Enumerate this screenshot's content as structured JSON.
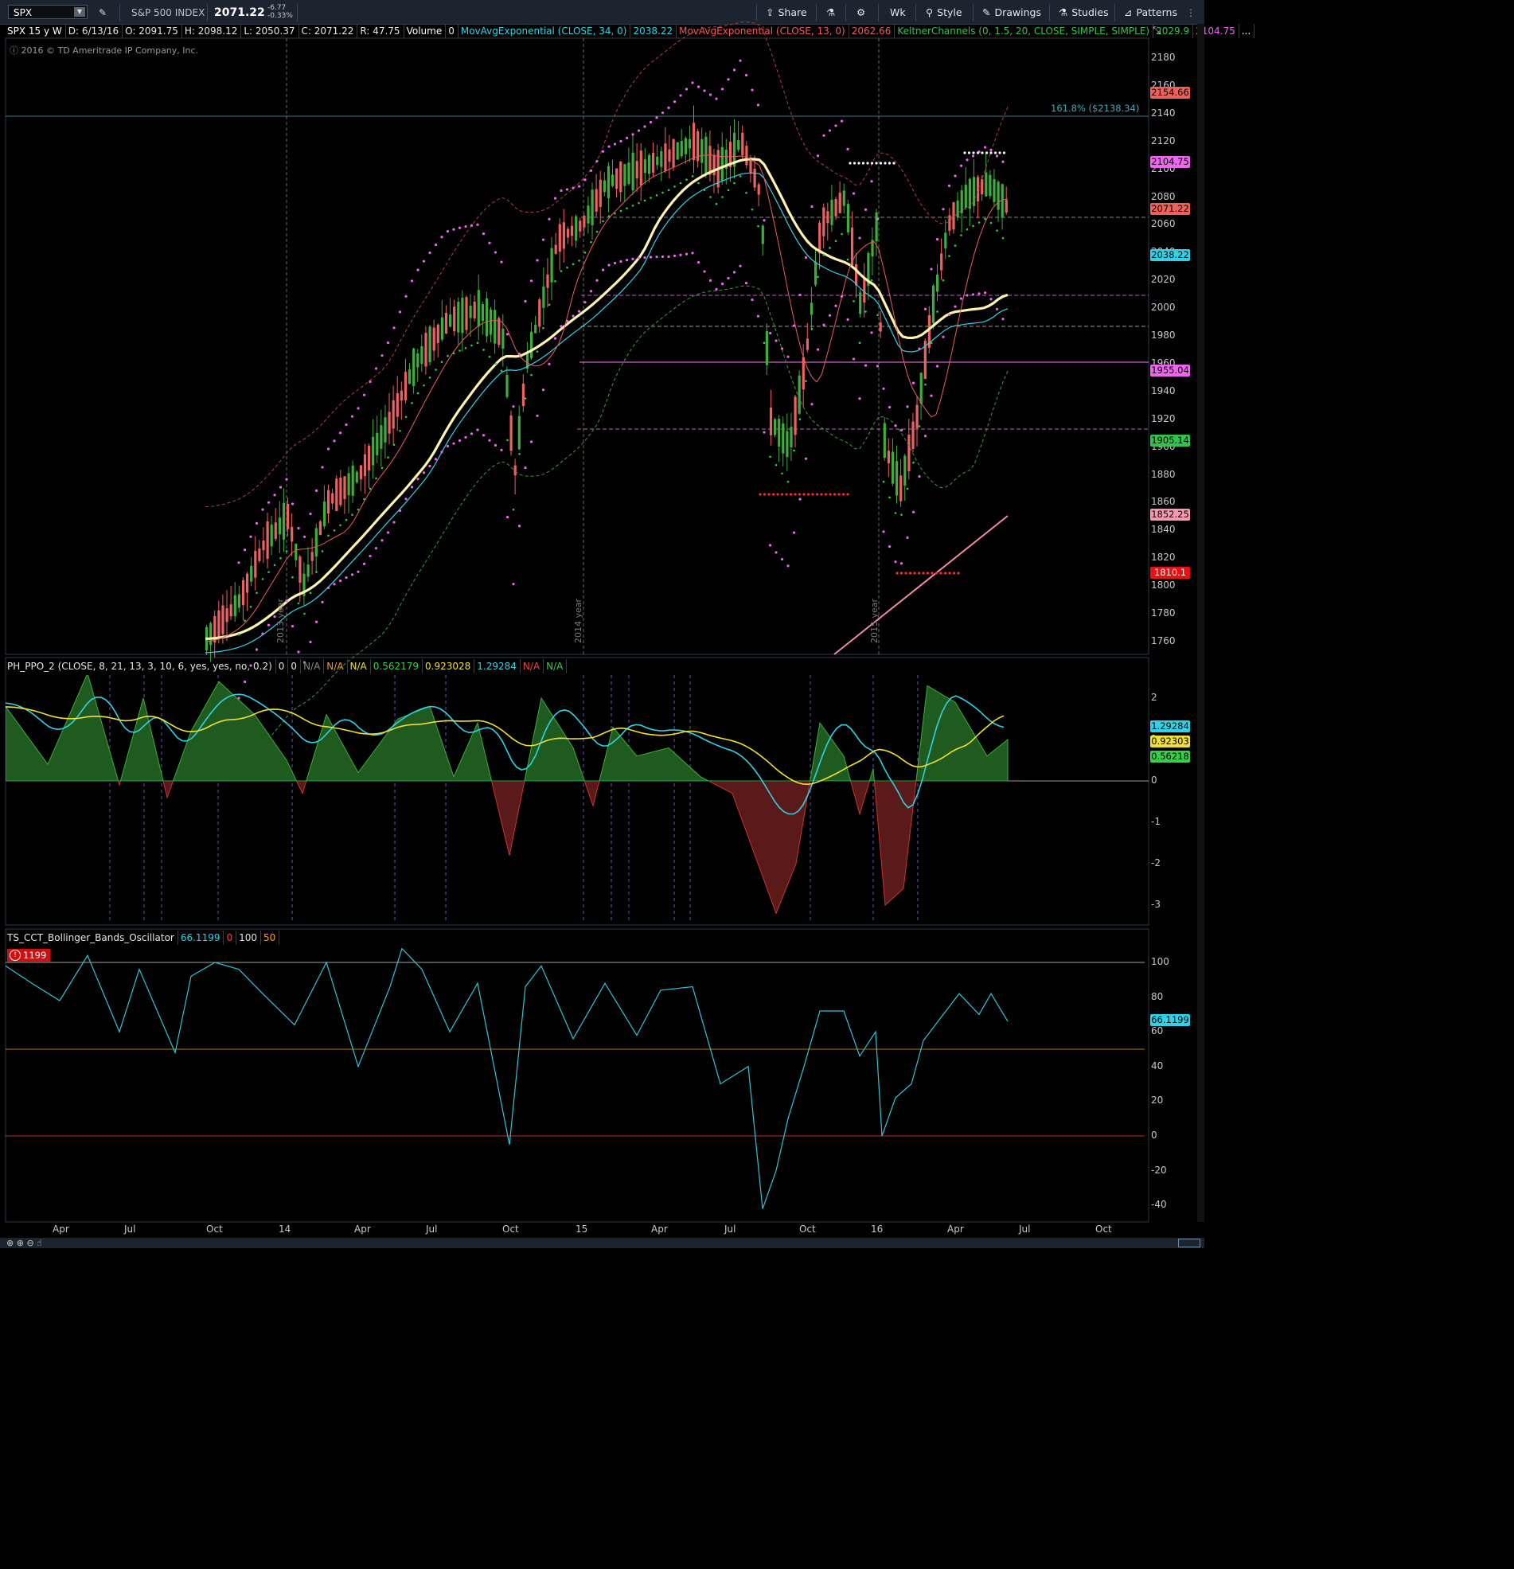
{
  "toolbar": {
    "symbol": "SPX",
    "description": "S&P 500 INDEX",
    "last": "2071.22",
    "change": "-6.77",
    "change_pct": "-0.33%",
    "buttons": {
      "share": "Share",
      "aggregation": "Wk",
      "style": "Style",
      "drawings": "Drawings",
      "studies": "Studies",
      "patterns": "Patterns"
    }
  },
  "infobar": {
    "items": [
      {
        "text": "SPX 15 y W",
        "color": "#ffffff"
      },
      {
        "text": "D: 6/13/16",
        "color": "#e6e6e6"
      },
      {
        "text": "O: 2091.75",
        "color": "#e6e6e6"
      },
      {
        "text": "H: 2098.12",
        "color": "#e6e6e6"
      },
      {
        "text": "L: 2050.37",
        "color": "#e6e6e6"
      },
      {
        "text": "C: 2071.22",
        "color": "#e6e6e6"
      },
      {
        "text": "R: 47.75",
        "color": "#e6e6e6"
      },
      {
        "text": "Volume",
        "color": "#ffffff"
      },
      {
        "text": "0",
        "color": "#e6e6e6"
      },
      {
        "text": "MovAvgExponential (CLOSE, 34, 0)",
        "color": "#2fd2e6"
      },
      {
        "text": "2038.22",
        "color": "#2fd2e6"
      },
      {
        "text": "MovAvgExponential (CLOSE, 13, 0)",
        "color": "#f05a5a"
      },
      {
        "text": "2062.66",
        "color": "#f05a5a"
      },
      {
        "text": "KeltnerChannels (0, 1.5, 20, CLOSE, SIMPLE, SIMPLE)",
        "color": "#34c34a"
      },
      {
        "text": "2029.9",
        "color": "#34c34a"
      },
      {
        "text": "2104.75",
        "color": "#ee66ee"
      },
      {
        "text": "...",
        "color": "#ffffff"
      }
    ],
    "copyright": "2016 © TD Ameritrade IP Company, Inc."
  },
  "ppo_bar": {
    "items": [
      {
        "text": "PH_PPO_2 (CLOSE, 8, 21, 13, 3, 10, 6, yes, yes, no, 0.2)",
        "color": "#e6e6e6"
      },
      {
        "text": "0",
        "color": "#e6e6e6"
      },
      {
        "text": "0",
        "color": "#e6e6e6"
      },
      {
        "text": "N/A",
        "color": "#8a8a8a"
      },
      {
        "text": "N/A",
        "color": "#f0a020"
      },
      {
        "text": "N/A",
        "color": "#f0e030"
      },
      {
        "text": "0.562179",
        "color": "#34d04a"
      },
      {
        "text": "0.923028",
        "color": "#f0e030"
      },
      {
        "text": "1.29284",
        "color": "#2fd2e6"
      },
      {
        "text": "N/A",
        "color": "#f04040"
      },
      {
        "text": "N/A",
        "color": "#34d04a"
      }
    ]
  },
  "bb_bar": {
    "items": [
      {
        "text": "TS_CCT_Bollinger_Bands_Oscillator",
        "color": "#e6e6e6"
      },
      {
        "text": "66.1199",
        "color": "#2fd2e6"
      },
      {
        "text": "0",
        "color": "#f04040"
      },
      {
        "text": "100",
        "color": "#e6e6e6"
      },
      {
        "text": "50",
        "color": "#f0a020"
      }
    ],
    "alert_value": "1199"
  },
  "price_panel": {
    "fib_label": "161.8%  ($2138.34)",
    "year_labels": [
      "2013 year",
      "2014 year",
      "2015 year"
    ],
    "axis_ticks": [
      "2180",
      "2160",
      "2140",
      "2120",
      "2100",
      "2080",
      "2060",
      "2040",
      "2020",
      "2000",
      "1980",
      "1960",
      "1940",
      "1920",
      "1900",
      "1880",
      "1860",
      "1840",
      "1820",
      "1800",
      "1780",
      "1760"
    ],
    "price_tags": [
      {
        "text": "2154.66",
        "color": "#f0605a"
      },
      {
        "text": "2104.75",
        "color": "#ee66ee"
      },
      {
        "text": "2071.22",
        "color": "#f0605a"
      },
      {
        "text": "2038.22",
        "color": "#2fd2e6"
      },
      {
        "text": "1955.04",
        "color": "#ee66ee"
      },
      {
        "text": "1905.14",
        "color": "#34c34a"
      },
      {
        "text": "1852.25",
        "color": "#f79ab0"
      },
      {
        "text": "1810.1",
        "color": "#e81010"
      }
    ]
  },
  "ppo_panel": {
    "axis_ticks": [
      "2",
      "1",
      "0",
      "-1",
      "-2",
      "-3"
    ],
    "tags": [
      {
        "text": "1.29284",
        "color": "#2fd2e6"
      },
      {
        "text": "0.92303",
        "color": "#f0e030"
      },
      {
        "text": "0.56218",
        "color": "#34d04a"
      }
    ]
  },
  "bb_panel": {
    "axis_ticks": [
      "100",
      "80",
      "60",
      "40",
      "20",
      "0",
      "-20",
      "-40"
    ],
    "tag": {
      "text": "66.1199",
      "color": "#2fd2e6"
    }
  },
  "x_axis": {
    "labels": [
      "Apr",
      "Jul",
      "Oct",
      "14",
      "Apr",
      "Jul",
      "Oct",
      "15",
      "Apr",
      "Jul",
      "Oct",
      "16",
      "Apr",
      "Jul",
      "Oct"
    ]
  }
}
